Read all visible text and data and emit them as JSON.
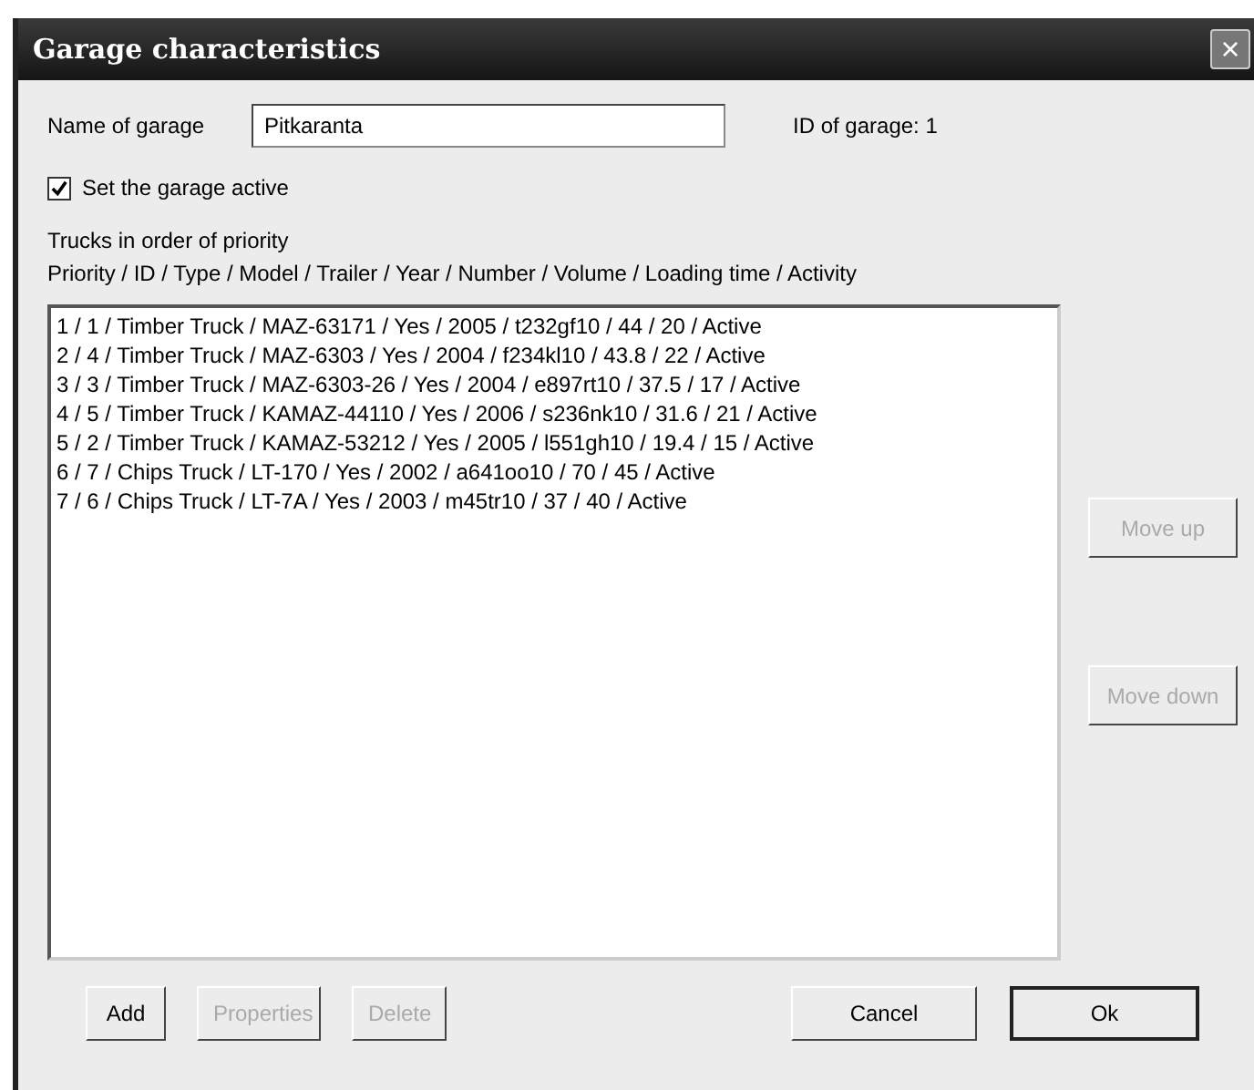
{
  "window": {
    "title": "Garage characteristics",
    "close": "×"
  },
  "name_label": "Name of garage",
  "name_value": "Pitkaranta",
  "id_label": "ID of garage: 1",
  "active_checkbox": {
    "label": "Set the garage active",
    "checked": true
  },
  "list_title": "Trucks in order of priority",
  "list_header": "Priority / ID / Type / Model / Trailer / Year / Number / Volume / Loading time / Activity",
  "trucks": [
    "1 / 1 / Timber Truck / MAZ-63171 / Yes / 2005 / t232gf10 / 44 / 20 / Active",
    "2 / 4 / Timber Truck / MAZ-6303 / Yes / 2004 / f234kl10 / 43.8 / 22 / Active",
    "3 / 3 / Timber Truck / MAZ-6303-26 / Yes / 2004 / e897rt10 / 37.5 / 17 / Active",
    "4 / 5 / Timber Truck / KAMAZ-44110 / Yes / 2006 / s236nk10 / 31.6 / 21 / Active",
    "5 / 2 / Timber Truck / KAMAZ-53212 / Yes / 2005 / l551gh10 / 19.4 / 15 / Active",
    "6 / 7 / Chips Truck / LT-170 / Yes / 2002 / a641oo10 / 70 / 45 / Active",
    "7 / 6 / Chips Truck / LT-7A / Yes / 2003 / m45tr10 / 37 / 40 / Active"
  ],
  "side_buttons": [
    {
      "label": "Move up",
      "disabled": true
    },
    {
      "label": "Move down",
      "disabled": true
    }
  ],
  "left_buttons": [
    {
      "label": "Add",
      "disabled": false
    },
    {
      "label": "Properties",
      "disabled": true
    },
    {
      "label": "Delete",
      "disabled": true
    }
  ],
  "right_buttons": [
    {
      "label": "Cancel",
      "disabled": false,
      "default": false
    },
    {
      "label": "Ok",
      "disabled": false,
      "default": true
    }
  ]
}
